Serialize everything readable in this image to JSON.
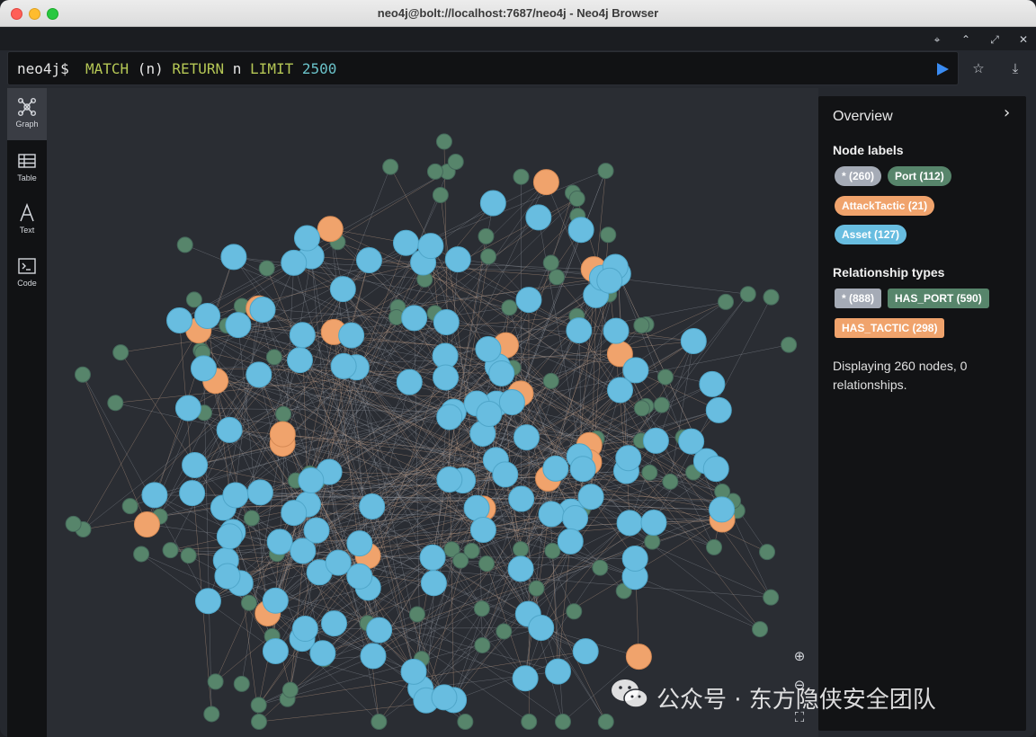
{
  "window": {
    "title": "neo4j@bolt://localhost:7687/neo4j - Neo4j Browser"
  },
  "editor": {
    "prompt": "neo4j$",
    "query_tokens": [
      {
        "text": "MATCH",
        "kind": "kw"
      },
      {
        "text": " (n) ",
        "kind": "plain"
      },
      {
        "text": "RETURN",
        "kind": "kw"
      },
      {
        "text": " n ",
        "kind": "plain"
      },
      {
        "text": "LIMIT",
        "kind": "kw"
      },
      {
        "text": " 2500",
        "kind": "num"
      }
    ]
  },
  "sidebar": {
    "items": [
      {
        "label": "Graph",
        "icon": "graph-icon",
        "active": true
      },
      {
        "label": "Table",
        "icon": "table-icon",
        "active": false
      },
      {
        "label": "Text",
        "icon": "text-icon",
        "active": false
      },
      {
        "label": "Code",
        "icon": "code-icon",
        "active": false
      }
    ]
  },
  "overview": {
    "title": "Overview",
    "node_labels_heading": "Node labels",
    "node_labels": [
      {
        "label": "* (260)",
        "color": "#a5abb6"
      },
      {
        "label": "Port (112)",
        "color": "#57856b"
      },
      {
        "label": "AttackTactic (21)",
        "color": "#f0a36c"
      },
      {
        "label": "Asset (127)",
        "color": "#68bde0"
      }
    ],
    "relationship_types_heading": "Relationship types",
    "relationship_types": [
      {
        "label": "* (888)",
        "color": "#a5abb6"
      },
      {
        "label": "HAS_PORT (590)",
        "color": "#57856b"
      },
      {
        "label": "HAS_TACTIC (298)",
        "color": "#f0a36c"
      }
    ],
    "summary": "Displaying 260 nodes, 0 relationships."
  },
  "graph": {
    "node_colors": {
      "Asset": "#68bde0",
      "Port": "#57856b",
      "AttackTactic": "#f0a36c"
    },
    "displayed_nodes": 260
  },
  "watermark": {
    "text": "公众号 · 东方隐侠安全团队",
    "icon": "wechat-icon"
  }
}
